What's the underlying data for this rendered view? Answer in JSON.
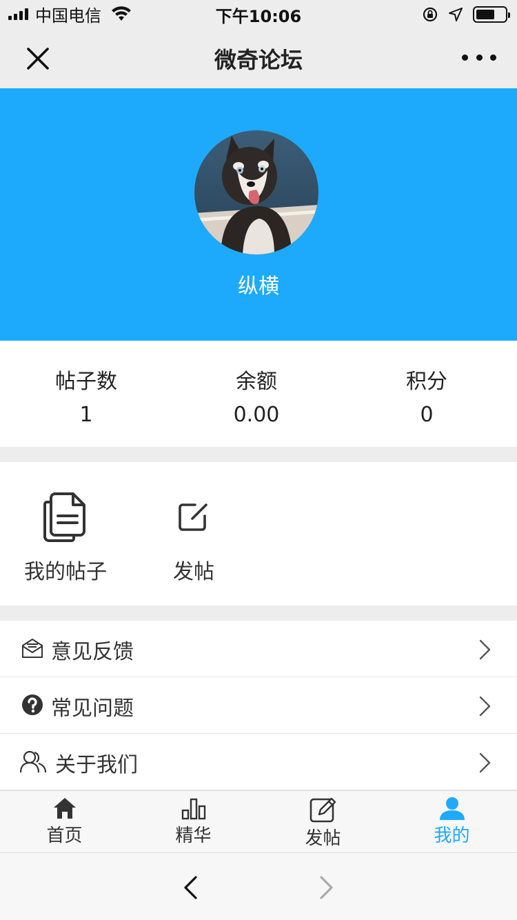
{
  "status_bar": {
    "carrier": "中国电信",
    "time": "下午10:06",
    "icons": [
      "signal-icon",
      "wifi-icon",
      "rotation-lock-icon",
      "location-icon",
      "battery-icon"
    ]
  },
  "nav": {
    "title": "微奇论坛",
    "close_icon": "close-icon",
    "more_icon": "more-icon"
  },
  "profile": {
    "username": "纵横",
    "avatar": "husky-dog-avatar",
    "background_color": "#1eaafc"
  },
  "stats": [
    {
      "label": "帖子数",
      "value": "1"
    },
    {
      "label": "余额",
      "value": "0.00"
    },
    {
      "label": "积分",
      "value": "0"
    }
  ],
  "actions": [
    {
      "label": "我的帖子",
      "icon": "documents-icon"
    },
    {
      "label": "发帖",
      "icon": "edit-icon"
    }
  ],
  "menu": [
    {
      "label": "意见反馈",
      "icon": "feedback-mail-icon"
    },
    {
      "label": "常见问题",
      "icon": "question-circle-icon"
    },
    {
      "label": "关于我们",
      "icon": "users-icon"
    }
  ],
  "tabs": [
    {
      "label": "首页",
      "icon": "home-icon",
      "active": false
    },
    {
      "label": "精华",
      "icon": "bar-chart-icon",
      "active": false
    },
    {
      "label": "发帖",
      "icon": "edit-square-icon",
      "active": false
    },
    {
      "label": "我的",
      "icon": "person-icon",
      "active": true
    }
  ],
  "browser": {
    "back_icon": "back-arrow-icon",
    "forward_icon": "forward-arrow-icon"
  },
  "colors": {
    "accent": "#1eaafc",
    "text": "#333333",
    "background": "#ededed"
  }
}
